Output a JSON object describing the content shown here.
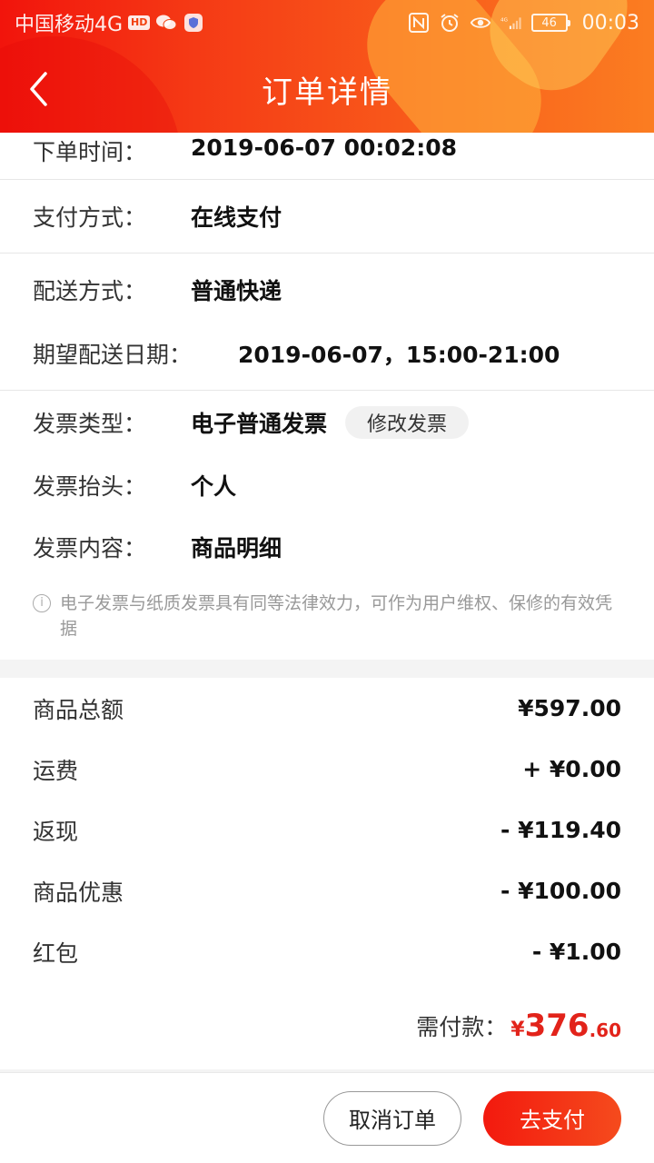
{
  "status_bar": {
    "carrier": "中国移动4G",
    "hd_badge": "HD",
    "battery_level": "46",
    "time": "00:03",
    "icons": [
      "wechat-icon",
      "shield-icon",
      "nfc-icon",
      "alarm-icon",
      "eye-icon",
      "signal-icon"
    ]
  },
  "navbar": {
    "title": "订单详情",
    "back_icon": "chevron-left-icon"
  },
  "order_info": {
    "order_time": {
      "label": "下单时间：",
      "value": "2019-06-07 00:02:08"
    },
    "payment_method": {
      "label": "支付方式：",
      "value": "在线支付"
    },
    "delivery_method": {
      "label": "配送方式：",
      "value": "普通快递"
    },
    "expected_delivery": {
      "label": "期望配送日期：",
      "value": "2019-06-07，15:00-21:00"
    }
  },
  "invoice": {
    "type": {
      "label": "发票类型：",
      "value": "电子普通发票"
    },
    "edit_button": "修改发票",
    "title": {
      "label": "发票抬头：",
      "value": "个人"
    },
    "content": {
      "label": "发票内容：",
      "value": "商品明细"
    },
    "notice": "电子发票与纸质发票具有同等法律效力，可作为用户维权、保修的有效凭据"
  },
  "amounts": [
    {
      "label": "商品总额",
      "value": "¥597.00"
    },
    {
      "label": "运费",
      "value": "+ ¥0.00"
    },
    {
      "label": "返现",
      "value": "- ¥119.40"
    },
    {
      "label": "商品优惠",
      "value": "- ¥100.00"
    },
    {
      "label": "红包",
      "value": "- ¥1.00"
    }
  ],
  "total": {
    "label": "需付款：",
    "currency": "¥",
    "integer": "376",
    "decimal": ".60"
  },
  "actions": {
    "cancel_label": "取消订单",
    "pay_label": "去支付"
  },
  "colors": {
    "accent": "#e2231a",
    "header_start": "#f2140c",
    "header_end": "#fb7d21"
  }
}
